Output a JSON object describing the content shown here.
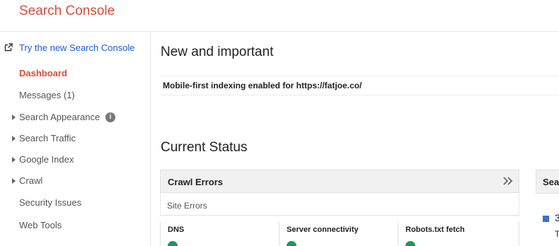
{
  "header": {
    "app_title": "Search Console"
  },
  "sidebar": {
    "try_new": "Try the new Search Console",
    "items": [
      {
        "label": "Dashboard",
        "active": true,
        "expandable": false
      },
      {
        "label": "Messages (1)",
        "active": false,
        "expandable": false
      },
      {
        "label": "Search Appearance",
        "active": false,
        "expandable": true,
        "info_icon": "info-icon"
      },
      {
        "label": "Search Traffic",
        "active": false,
        "expandable": true
      },
      {
        "label": "Google Index",
        "active": false,
        "expandable": true
      },
      {
        "label": "Crawl",
        "active": false,
        "expandable": true
      },
      {
        "label": "Security Issues",
        "active": false,
        "expandable": false
      },
      {
        "label": "Web Tools",
        "active": false,
        "expandable": false
      }
    ]
  },
  "main": {
    "new_important": {
      "heading": "New and important",
      "notice": "Mobile-first indexing enabled for https://fatjoe.co/"
    },
    "current_status": {
      "heading": "Current Status",
      "crawl_errors": {
        "title": "Crawl Errors",
        "subtitle": "Site Errors",
        "columns": [
          {
            "label": "DNS",
            "status_icon": "check-circle-icon"
          },
          {
            "label": "Server connectivity",
            "status_icon": "check-circle-icon"
          },
          {
            "label": "Robots.txt fetch",
            "status_icon": "check-circle-icon"
          }
        ]
      },
      "next_card": {
        "title_partial": "Sea",
        "legend_value": "3",
        "legend_sub": "T"
      }
    }
  },
  "colors": {
    "brand_red": "#dd4b39",
    "link_blue": "#1a5ad8",
    "status_green": "#0f9d58",
    "legend_blue": "#3a6fd8"
  }
}
